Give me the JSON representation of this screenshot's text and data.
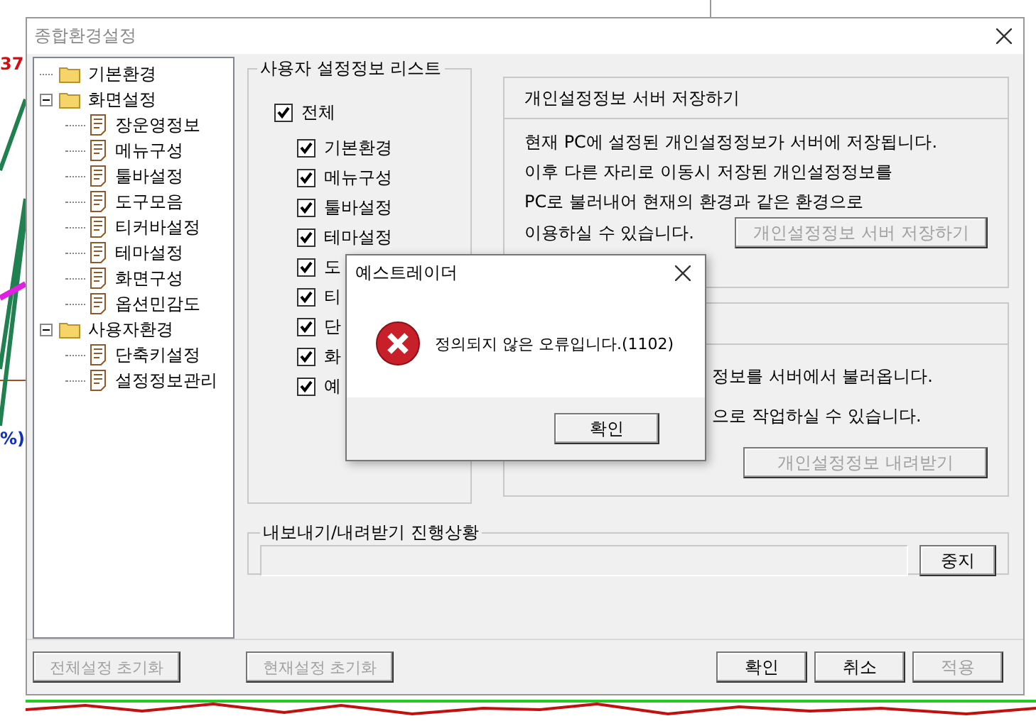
{
  "background": {
    "texts": [
      "37",
      "%)"
    ]
  },
  "window": {
    "title": "종합환경설정"
  },
  "tree": [
    {
      "label": "기본환경",
      "kind": "folder"
    },
    {
      "label": "화면설정",
      "kind": "folder",
      "expanded": true,
      "children": [
        {
          "label": "장운영정보",
          "kind": "page"
        },
        {
          "label": "메뉴구성",
          "kind": "page"
        },
        {
          "label": "툴바설정",
          "kind": "page"
        },
        {
          "label": "도구모음",
          "kind": "page"
        },
        {
          "label": "티커바설정",
          "kind": "page"
        },
        {
          "label": "테마설정",
          "kind": "page"
        },
        {
          "label": "화면구성",
          "kind": "page"
        },
        {
          "label": "옵션민감도",
          "kind": "page"
        }
      ]
    },
    {
      "label": "사용자환경",
      "kind": "folder",
      "expanded": true,
      "children": [
        {
          "label": "단축키설정",
          "kind": "page"
        },
        {
          "label": "설정정보관리",
          "kind": "page"
        }
      ]
    }
  ],
  "settings_list": {
    "title": "사용자 설정정보 리스트",
    "all": {
      "label": "전체",
      "checked": true
    },
    "items": [
      {
        "label": "기본환경",
        "checked": true
      },
      {
        "label": "메뉴구성",
        "checked": true
      },
      {
        "label": "툴바설정",
        "checked": true
      },
      {
        "label": "테마설정",
        "checked": true
      },
      {
        "label": "도",
        "checked": true
      },
      {
        "label": "티",
        "checked": true
      },
      {
        "label": "단",
        "checked": true
      },
      {
        "label": "화",
        "checked": true
      },
      {
        "label": "예",
        "checked": true
      }
    ]
  },
  "save_panel": {
    "title": "개인설정정보 서버 저장하기",
    "lines": [
      "현재 PC에 설정된 개인설정정보가 서버에 저장됩니다.",
      "이후 다른 자리로 이동시 저장된 개인설정정보를",
      "PC로 불러내어 현재의 환경과 같은 환경으로",
      "이용하실 수 있습니다."
    ],
    "button": {
      "label": "개인설정정보 서버 저장하기",
      "disabled": true
    }
  },
  "load_panel": {
    "lines": [
      "정보를 서버에서 불러옵니다.",
      "으로 작업하실 수 있습니다."
    ],
    "button": {
      "label": "개인설정정보 내려받기",
      "disabled": true
    }
  },
  "progress": {
    "title": "내보내기/내려받기 진행상황",
    "level": 0,
    "button": {
      "label": "중지",
      "disabled": false
    }
  },
  "footer_left": [
    {
      "label": "전체설정 초기화",
      "disabled": true
    },
    {
      "label": "현재설정 초기화",
      "disabled": true
    }
  ],
  "footer_right": [
    {
      "label": "확인",
      "disabled": false
    },
    {
      "label": "취소",
      "disabled": false
    },
    {
      "label": "적용",
      "disabled": true
    }
  ],
  "error_dialog": {
    "title": "예스트레이더",
    "message": "정의되지 않은 오류입니다.(1102)",
    "button": "확인"
  }
}
